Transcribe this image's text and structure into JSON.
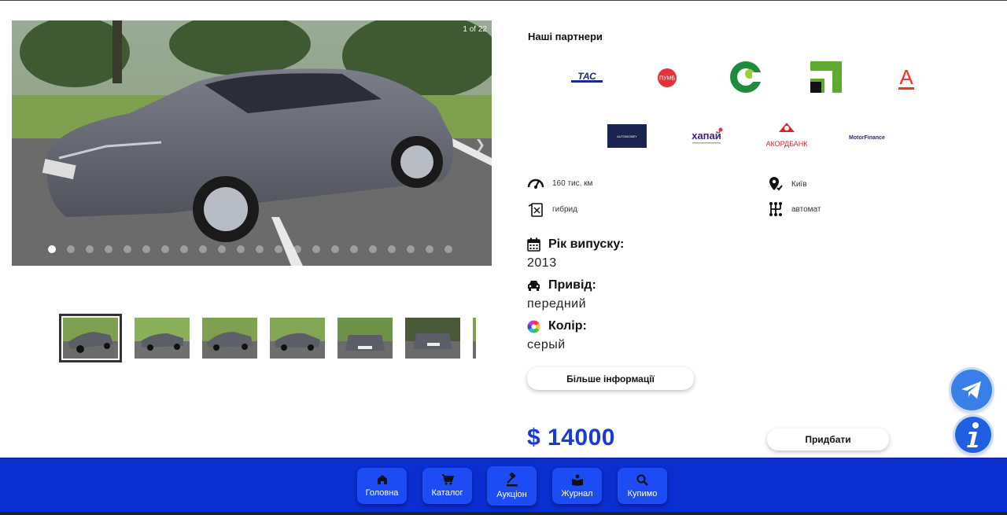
{
  "gallery": {
    "counter": "1 of 22",
    "dots_count": 22,
    "active_dot": 0,
    "thumbnails": [
      "photo-1",
      "photo-2",
      "photo-3",
      "photo-4",
      "photo-5",
      "photo-6",
      "photo-7"
    ],
    "next_icon": "chevron-right-icon"
  },
  "partners": {
    "title": "Наші партнери",
    "logos": [
      "ТАС",
      "ПУМБ",
      "Ощадбанк",
      "ПриватБанк",
      "А",
      "AUTOMONEY",
      "хапай",
      "АКОРДБАНК",
      "MotorFinance"
    ]
  },
  "specs": {
    "mileage": "160 тис. км",
    "city": "Київ",
    "fuel": "гибрид",
    "transmission": "автомат"
  },
  "attributes": {
    "year_label": "Рік випуску:",
    "year_value": "2013",
    "drive_label": "Привід:",
    "drive_value": "передний",
    "color_label": "Колір:",
    "color_value": "серый"
  },
  "more_info_label": "Більше інформації",
  "price": "$ 14000",
  "buy_label": "Придбати",
  "nav": {
    "home": "Головна",
    "catalog": "Каталог",
    "auction": "Аукціон",
    "journal": "Журнал",
    "buy": "Купимо"
  },
  "colors": {
    "accent": "#1a3ad6",
    "nav_bg": "#0a2ed0",
    "nav_button": "#1e4cf4"
  }
}
